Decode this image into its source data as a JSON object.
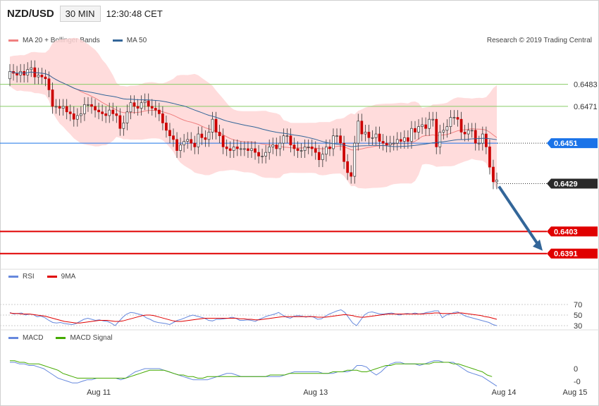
{
  "header": {
    "symbol": "NZD/USD",
    "timeframe": "30 MIN",
    "clock": "12:30:48 CET"
  },
  "copyright": "Research © 2019 Trading Central",
  "colors": {
    "up_candle": "#ffffff",
    "down_candle": "#cc0000",
    "wick": "#333333",
    "ma20": "#f08080",
    "bollinger_fill": "#ffd6d6",
    "ma50": "#336699",
    "pivot_green": "#88cc66",
    "support_red": "#e00000",
    "current_price": "#2a2a2a",
    "ma50_tag": "#1a73e8",
    "rsi": "#6688dd",
    "rsi_ma": "#e00000",
    "macd": "#6688dd",
    "macd_signal": "#44aa00",
    "arrow": "#336699"
  },
  "chart_data": [
    {
      "type": "candlestick",
      "panel": "price",
      "legend": [
        {
          "name": "MA 20 + Bollinger Bands",
          "color": "#f08080"
        },
        {
          "name": "MA 50",
          "color": "#336699"
        }
      ],
      "ylim": [
        0.6384,
        0.6502
      ],
      "x_ticks": [
        {
          "label": "Aug 11",
          "index": 25
        },
        {
          "label": "Aug 13",
          "index": 86
        },
        {
          "label": "Aug 14",
          "index": 139
        },
        {
          "label": "Aug 15",
          "index": 159
        }
      ],
      "levels": [
        {
          "label": "0.6483",
          "value": 0.6483,
          "color": "#88cc66",
          "style": "solid"
        },
        {
          "label": "0.6471",
          "value": 0.6471,
          "color": "#88cc66",
          "style": "solid"
        },
        {
          "label": "0.6451",
          "value": 0.6451,
          "color": "#1a73e8",
          "style": "tag"
        },
        {
          "label": "0.6429",
          "value": 0.6429,
          "color": "#2a2a2a",
          "style": "dotted"
        },
        {
          "label": "0.6403",
          "value": 0.6403,
          "color": "#e00000",
          "style": "solid-thick"
        },
        {
          "label": "0.6391",
          "value": 0.6391,
          "color": "#e00000",
          "style": "solid-thick"
        }
      ],
      "forecast_arrow": {
        "from_value": 0.6429,
        "to_value": 0.6391
      },
      "closes": [
        0.649,
        0.6489,
        0.6488,
        0.649,
        0.6488,
        0.6491,
        0.6492,
        0.6487,
        0.6488,
        0.6487,
        0.6486,
        0.648,
        0.6471,
        0.6471,
        0.647,
        0.6471,
        0.6468,
        0.6467,
        0.6464,
        0.6466,
        0.6467,
        0.6472,
        0.6472,
        0.6471,
        0.6469,
        0.6468,
        0.6467,
        0.6466,
        0.6469,
        0.6467,
        0.6466,
        0.6459,
        0.6462,
        0.6468,
        0.6473,
        0.6471,
        0.647,
        0.6473,
        0.6474,
        0.6471,
        0.647,
        0.6469,
        0.6467,
        0.6462,
        0.6458,
        0.6455,
        0.6453,
        0.6447,
        0.645,
        0.6452,
        0.6453,
        0.6451,
        0.6449,
        0.6456,
        0.6454,
        0.6453,
        0.6457,
        0.6464,
        0.6457,
        0.6455,
        0.6449,
        0.6448,
        0.6447,
        0.6449,
        0.6448,
        0.6448,
        0.6448,
        0.6447,
        0.6448,
        0.6446,
        0.6444,
        0.6444,
        0.6446,
        0.6449,
        0.645,
        0.6448,
        0.6451,
        0.6455,
        0.6455,
        0.645,
        0.6448,
        0.6447,
        0.6447,
        0.6449,
        0.6449,
        0.6448,
        0.6446,
        0.6442,
        0.6445,
        0.6449,
        0.6448,
        0.6455,
        0.6455,
        0.6451,
        0.6441,
        0.6435,
        0.6433,
        0.6451,
        0.6463,
        0.6456,
        0.6457,
        0.6454,
        0.6454,
        0.6456,
        0.6452,
        0.6451,
        0.645,
        0.6451,
        0.6451,
        0.6453,
        0.6452,
        0.6454,
        0.6452,
        0.6459,
        0.6457,
        0.646,
        0.6461,
        0.6459,
        0.6464,
        0.6464,
        0.6449,
        0.6457,
        0.6458,
        0.646,
        0.6465,
        0.6465,
        0.6464,
        0.6457,
        0.6456,
        0.6458,
        0.6458,
        0.6451,
        0.6451,
        0.6456,
        0.6449,
        0.6438,
        0.643,
        0.6431
      ],
      "opens": [
        0.6486,
        0.649,
        0.6489,
        0.6488,
        0.649,
        0.6488,
        0.6491,
        0.6492,
        0.6487,
        0.6488,
        0.6487,
        0.6486,
        0.648,
        0.6471,
        0.6471,
        0.647,
        0.6471,
        0.6468,
        0.6467,
        0.6464,
        0.6466,
        0.6467,
        0.6472,
        0.6472,
        0.6471,
        0.6469,
        0.6468,
        0.6467,
        0.6466,
        0.6469,
        0.6467,
        0.6466,
        0.6459,
        0.6462,
        0.6468,
        0.6473,
        0.6471,
        0.647,
        0.6473,
        0.6474,
        0.6471,
        0.647,
        0.6469,
        0.6467,
        0.6462,
        0.6458,
        0.6455,
        0.6453,
        0.6447,
        0.645,
        0.6452,
        0.6453,
        0.6451,
        0.6449,
        0.6456,
        0.6454,
        0.6453,
        0.6457,
        0.6464,
        0.6457,
        0.6455,
        0.6449,
        0.6448,
        0.6447,
        0.6449,
        0.6448,
        0.6448,
        0.6448,
        0.6447,
        0.6448,
        0.6446,
        0.6444,
        0.6444,
        0.6446,
        0.6449,
        0.645,
        0.6448,
        0.6451,
        0.6455,
        0.6455,
        0.645,
        0.6448,
        0.6447,
        0.6447,
        0.6449,
        0.6449,
        0.6448,
        0.6446,
        0.6442,
        0.6445,
        0.6449,
        0.6448,
        0.6455,
        0.6455,
        0.6451,
        0.6441,
        0.6435,
        0.6433,
        0.6451,
        0.6463,
        0.6456,
        0.6457,
        0.6454,
        0.6454,
        0.6456,
        0.6452,
        0.6451,
        0.645,
        0.6451,
        0.6451,
        0.6453,
        0.6452,
        0.6454,
        0.6452,
        0.6459,
        0.6457,
        0.646,
        0.6461,
        0.6459,
        0.6464,
        0.6464,
        0.6449,
        0.6457,
        0.6458,
        0.646,
        0.6465,
        0.6465,
        0.6464,
        0.6457,
        0.6456,
        0.6458,
        0.6458,
        0.6451,
        0.6451,
        0.6456,
        0.6449,
        0.6438,
        0.643
      ]
    },
    {
      "type": "line",
      "panel": "rsi",
      "legend": [
        {
          "name": "RSI",
          "color": "#6688dd"
        },
        {
          "name": "9MA",
          "color": "#e00000"
        }
      ],
      "ylim": [
        20,
        80
      ],
      "y_ticks": [
        "70",
        "50",
        "30"
      ],
      "y_tick_values": [
        70,
        50,
        30
      ],
      "series": [
        {
          "name": "RSI",
          "values": [
            55,
            52,
            53,
            54,
            50,
            52,
            51,
            47,
            48,
            45,
            40,
            36,
            35,
            36,
            34,
            33,
            32,
            34,
            38,
            42,
            44,
            42,
            40,
            41,
            39,
            38,
            35,
            30,
            38,
            46,
            52,
            55,
            54,
            52,
            50,
            45,
            42,
            38,
            36,
            35,
            34,
            32,
            36,
            40,
            42,
            45,
            48,
            50,
            48,
            46,
            44,
            40,
            39,
            42,
            42,
            43,
            44,
            46,
            44,
            40,
            40,
            41,
            40,
            38,
            42,
            45,
            48,
            50,
            52,
            55,
            50,
            46,
            44,
            48,
            49,
            48,
            46,
            48,
            46,
            42,
            43,
            48,
            52,
            55,
            58,
            60,
            55,
            45,
            35,
            30,
            40,
            50,
            55,
            56,
            54,
            52,
            52,
            53,
            54,
            52,
            50,
            52,
            53,
            52,
            54,
            52,
            53,
            55,
            56,
            58,
            58,
            45,
            50,
            52,
            55,
            56,
            52,
            48,
            46,
            44,
            42,
            40,
            38,
            36,
            32,
            30
          ]
        },
        {
          "name": "9MA",
          "values": [
            54,
            53,
            53,
            52,
            52,
            52,
            51,
            50,
            49,
            48,
            46,
            44,
            42,
            40,
            38,
            37,
            36,
            35,
            35,
            36,
            37,
            38,
            39,
            40,
            40,
            40,
            39,
            38,
            38,
            39,
            41,
            43,
            45,
            47,
            49,
            50,
            50,
            49,
            47,
            45,
            43,
            41,
            39,
            38,
            38,
            39,
            40,
            41,
            42,
            43,
            44,
            44,
            44,
            44,
            44,
            44,
            44,
            44,
            44,
            43,
            43,
            42,
            42,
            41,
            41,
            42,
            43,
            44,
            45,
            46,
            47,
            47,
            47,
            47,
            47,
            47,
            47,
            47,
            47,
            46,
            46,
            46,
            47,
            48,
            49,
            50,
            51,
            50,
            49,
            47,
            46,
            46,
            47,
            48,
            49,
            50,
            51,
            52,
            52,
            52,
            52,
            52,
            52,
            52,
            52,
            52,
            52,
            53,
            53,
            54,
            54,
            53,
            53,
            53,
            53,
            54,
            54,
            53,
            52,
            51,
            50,
            49,
            47,
            46,
            44,
            42
          ]
        }
      ]
    },
    {
      "type": "line",
      "panel": "macd",
      "legend": [
        {
          "name": "MACD",
          "color": "#6688dd"
        },
        {
          "name": "MACD Signal",
          "color": "#44aa00"
        }
      ],
      "ylim": [
        -0.0012,
        0.0012
      ],
      "y_ticks": [
        "0",
        "-0"
      ],
      "y_tick_values": [
        0.0,
        -0.0008
      ],
      "series": [
        {
          "name": "MACD",
          "values": [
            0.0004,
            0.0004,
            0.0003,
            0.0003,
            0.0002,
            0.0002,
            0.0001,
            0.0,
            -0.0002,
            -0.0004,
            -0.0006,
            -0.0007,
            -0.0008,
            -0.0009,
            -0.0009,
            -0.0008,
            -0.0007,
            -0.0007,
            -0.0006,
            -0.0006,
            -0.0006,
            -0.0006,
            -0.0006,
            -0.0007,
            -0.0006,
            -0.0004,
            -0.0002,
            -0.0001,
            0.0,
            0.0,
            0.0,
            0.0,
            -0.0001,
            -0.0002,
            -0.0003,
            -0.0004,
            -0.0005,
            -0.0006,
            -0.0007,
            -0.0007,
            -0.0007,
            -0.0007,
            -0.0006,
            -0.0005,
            -0.0004,
            -0.0003,
            -0.0003,
            -0.0004,
            -0.0005,
            -0.0005,
            -0.0005,
            -0.0005,
            -0.0005,
            -0.0005,
            -0.0005,
            -0.0005,
            -0.0005,
            -0.0004,
            -0.0003,
            -0.0002,
            -0.0002,
            -0.0002,
            -0.0002,
            -0.0002,
            -0.0002,
            -0.0003,
            -0.0003,
            -0.0003,
            -0.0002,
            -0.0002,
            -0.0002,
            -0.0001,
            0.0002,
            0.0002,
            0.0001,
            -0.0002,
            -0.0004,
            -0.0002,
            0.0001,
            0.0003,
            0.0004,
            0.0004,
            0.0003,
            0.0003,
            0.0003,
            0.0002,
            0.0003,
            0.0004,
            0.0005,
            0.0005,
            0.0004,
            0.0004,
            0.0004,
            0.0002,
            0.0,
            -0.0002,
            -0.0003,
            -0.0004,
            -0.0005,
            -0.0007,
            -0.0009,
            -0.0011
          ]
        },
        {
          "name": "MACD Signal",
          "values": [
            0.0005,
            0.0005,
            0.0004,
            0.0004,
            0.0003,
            0.0003,
            0.0003,
            0.0002,
            0.0001,
            0.0,
            -0.0001,
            -0.0003,
            -0.0004,
            -0.0005,
            -0.0006,
            -0.0006,
            -0.0006,
            -0.0006,
            -0.0006,
            -0.0006,
            -0.0006,
            -0.0006,
            -0.0006,
            -0.0006,
            -0.0006,
            -0.0005,
            -0.0004,
            -0.0003,
            -0.0002,
            -0.0001,
            -0.0001,
            -0.0001,
            -0.0001,
            -0.0002,
            -0.0003,
            -0.0004,
            -0.0004,
            -0.0005,
            -0.0005,
            -0.0006,
            -0.0006,
            -0.0005,
            -0.0005,
            -0.0005,
            -0.0005,
            -0.0005,
            -0.0005,
            -0.0005,
            -0.0005,
            -0.0005,
            -0.0005,
            -0.0005,
            -0.0005,
            -0.0005,
            -0.0004,
            -0.0004,
            -0.0004,
            -0.0004,
            -0.0003,
            -0.0003,
            -0.0003,
            -0.0003,
            -0.0003,
            -0.0003,
            -0.0003,
            -0.0003,
            -0.0003,
            -0.0002,
            -0.0002,
            -0.0002,
            -0.0001,
            -0.0001,
            -0.0001,
            -0.0002,
            -0.0002,
            -0.0001,
            0.0,
            0.0001,
            0.0002,
            0.0002,
            0.0003,
            0.0003,
            0.0003,
            0.0003,
            0.0003,
            0.0003,
            0.0003,
            0.0003,
            0.0004,
            0.0004,
            0.0004,
            0.0004,
            0.0003,
            0.0003,
            0.0002,
            0.0001,
            0.0,
            -0.0001,
            -0.0002,
            -0.0004,
            -0.0005
          ]
        }
      ]
    }
  ]
}
